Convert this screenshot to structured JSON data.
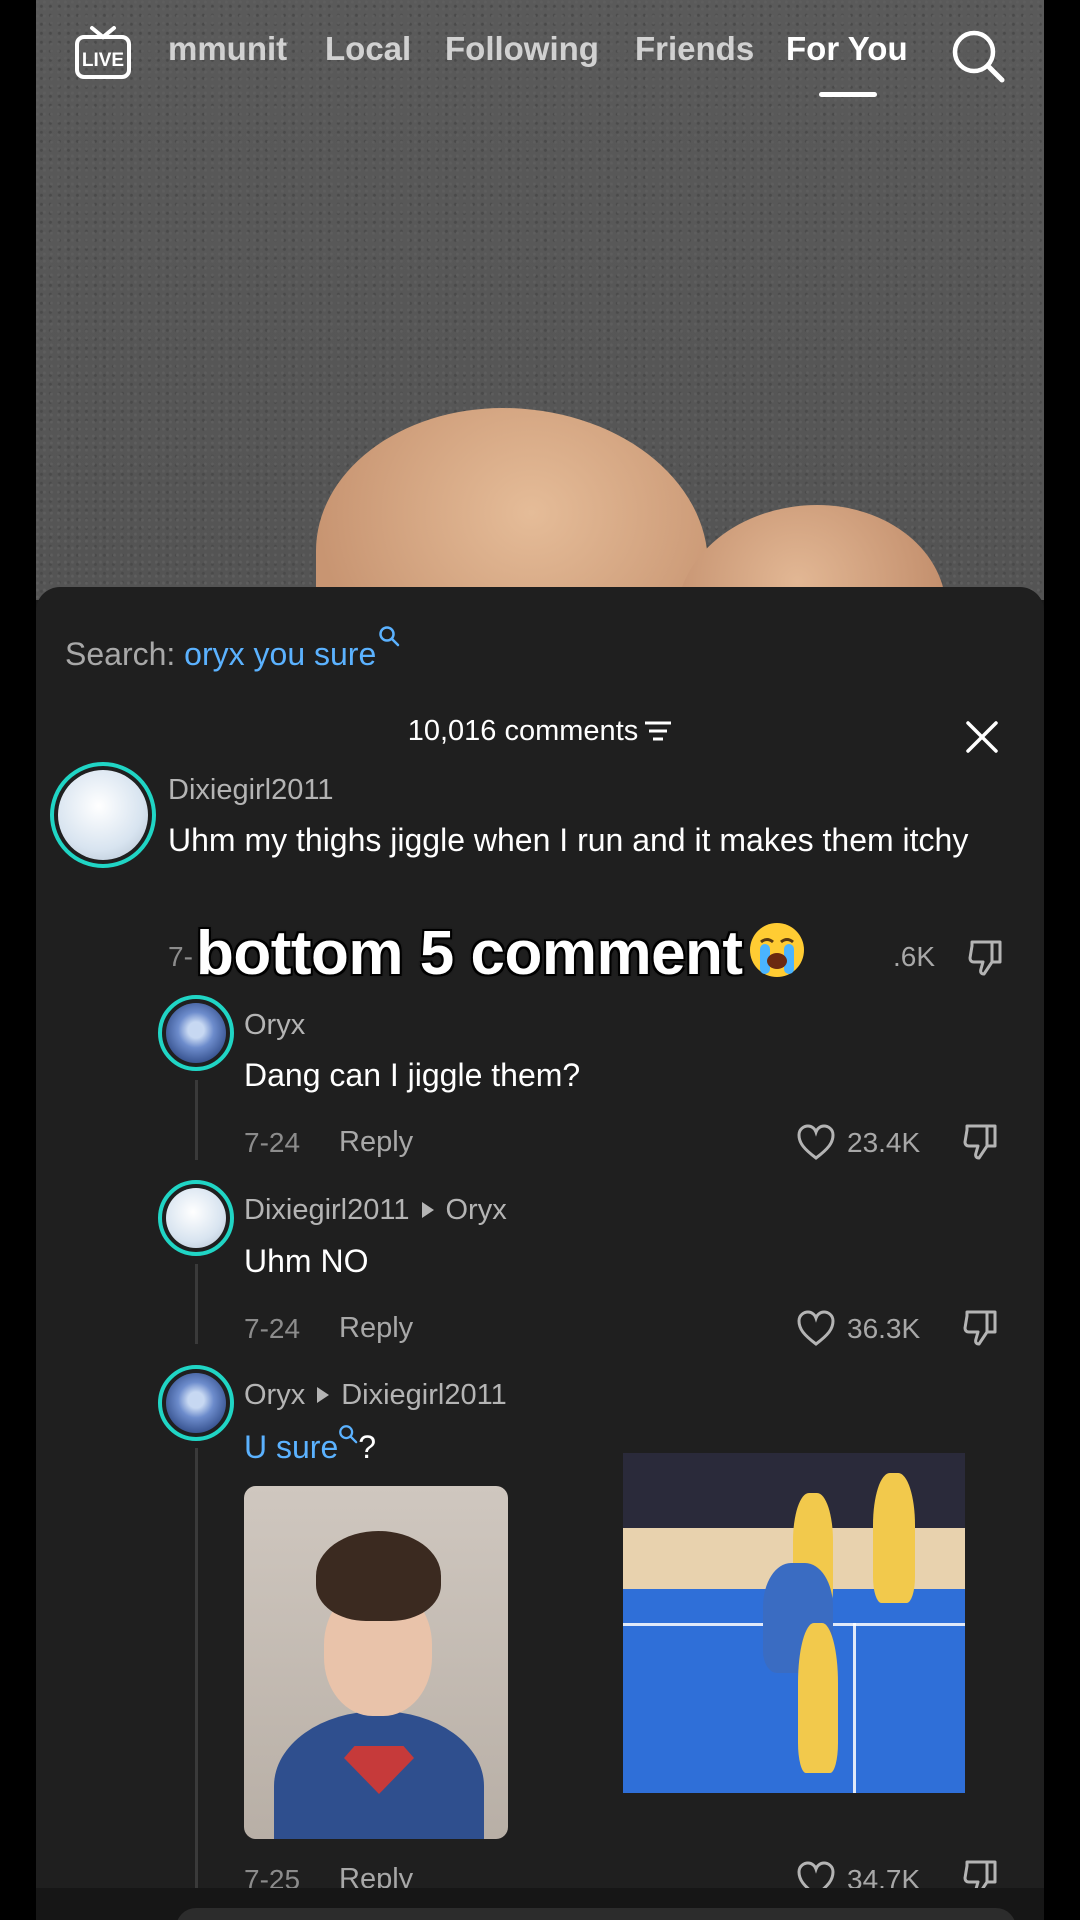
{
  "nav": {
    "tabs": [
      "mmunity",
      "Local",
      "Following",
      "Friends",
      "For You"
    ],
    "active_tab": "For You",
    "live_label": "LIVE"
  },
  "sheet": {
    "search_label": "Search:",
    "search_query": "oryx you sure",
    "comments_count": "10,016 comments"
  },
  "comments": [
    {
      "username": "Dixiegirl2011",
      "text": "Uhm my thighs jiggle when I run and it makes them itchy",
      "date": "7-",
      "likes": ".6K"
    },
    {
      "username": "Oryx",
      "text": "Dang can I jiggle them?",
      "date": "7-24",
      "reply": "Reply",
      "likes": "23.4K"
    },
    {
      "username": "Dixiegirl2011",
      "reply_to": "Oryx",
      "text": "Uhm NO",
      "date": "7-24",
      "reply": "Reply",
      "likes": "36.3K"
    },
    {
      "username": "Oryx",
      "reply_to": "Dixiegirl2011",
      "text_link": "U sure",
      "text_suffix": "?",
      "date": "7-25",
      "reply": "Reply",
      "likes": "34.7K"
    }
  ],
  "overlay_caption": "bottom 5 comment",
  "colors": {
    "accent_teal": "#20d5c5",
    "link_blue": "#5bb2ff",
    "sheet_bg": "#1f1f1f"
  }
}
